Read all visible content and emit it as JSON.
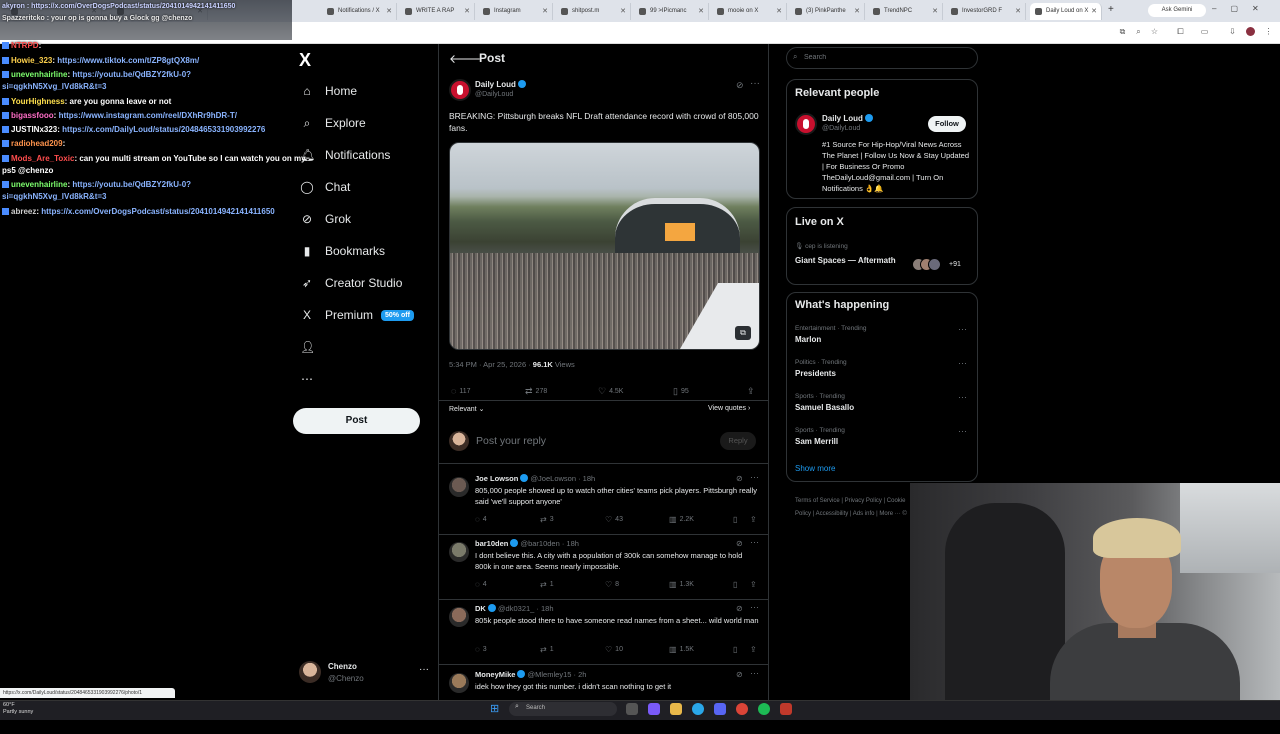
{
  "browser": {
    "tabs": [
      {
        "label": "",
        "x": 0
      },
      {
        "label": "",
        "x": 0
      },
      {
        "label": "Notifications / X",
        "x": 0
      },
      {
        "label": "WRITE A RAP",
        "x": 0
      },
      {
        "label": "Instagram",
        "x": 0
      },
      {
        "label": "shitpost.m",
        "x": 0
      },
      {
        "label": "99 >IPicmanc",
        "x": 0
      },
      {
        "label": "mooie on X",
        "x": 0
      },
      {
        "label": "(3) PinkPanthe",
        "x": 0
      },
      {
        "label": "TrendNPC",
        "x": 0
      },
      {
        "label": "InvestorGRD F",
        "x": 0
      },
      {
        "label": "Daily Loud on X",
        "x": 0
      }
    ],
    "ask_gemini": "Ask Gemini"
  },
  "chat": {
    "messages": [
      {
        "user": "NTRPD",
        "text": ":",
        "link": "",
        "ucolor": "#ff4d4d"
      },
      {
        "user": "Howie_323",
        "text": ": ",
        "link": "https://www.tiktok.com/t/ZP8gtQX8m/",
        "ucolor": "#ffd24d"
      },
      {
        "user": "unevenhairline",
        "text": ": ",
        "link": "https://youtu.be/QdBZY2fkU-0?",
        "ucolor": "#7dff6e"
      },
      {
        "user": "",
        "text": "",
        "link": "si=qgkhN5Xvg_lVd8kR&amp;t=3",
        "ucolor": "#ffffff"
      },
      {
        "user": "YourHighness",
        "text": ": are you gonna leave or not",
        "link": "",
        "ucolor": "#ffe04d"
      },
      {
        "user": "bigassfooo",
        "text": ": ",
        "link": "https://www.instagram.com/reel/DXhRr9hDR-T/",
        "ucolor": "#ff6ec7"
      },
      {
        "user": "JUSTINx323",
        "text": ": ",
        "link": "https://x.com/DailyLoud/status/2048465331903992276",
        "ucolor": "#ffffff"
      },
      {
        "user": "radiohead209",
        "text": ":",
        "link": "",
        "ucolor": "#ff944d"
      },
      {
        "user": "Mods_Are_Toxic",
        "text": ": can you multi stream on YouTube so I can watch you on my",
        "link": "",
        "ucolor": "#ff4d4d"
      },
      {
        "user": "",
        "text": "ps5 @chenzo",
        "link": "",
        "ucolor": "#ffffff"
      },
      {
        "user": "unevenhairline",
        "text": ": ",
        "link": "https://youtu.be/QdBZY2fkU-0?",
        "ucolor": "#7dff6e"
      },
      {
        "user": "",
        "text": "",
        "link": "si=qgkhN5Xvg_lVd8kR&amp;t=3",
        "ucolor": "#ffffff"
      },
      {
        "user": "abreez",
        "text": ": ",
        "link": "https://x.com/OverDogsPodcast/status/2041014942141411650",
        "ucolor": "#cfcfcf"
      }
    ],
    "top_line_1": "akyron : https://x.com/OverDogsPodcast/status/2041014942141411650",
    "top_line_2": "Spazzeritcko : your op is gonna buy a Glock gg @chenzo"
  },
  "nav": {
    "logo": "X",
    "items": [
      {
        "label": "Home",
        "icon": "⌂",
        "name": "home"
      },
      {
        "label": "Explore",
        "icon": "⌕",
        "name": "explore"
      },
      {
        "label": "Notifications",
        "icon": "🔔︎",
        "name": "notifications"
      },
      {
        "label": "Chat",
        "icon": "◯",
        "name": "chat"
      },
      {
        "label": "Grok",
        "icon": "⊘",
        "name": "grok"
      },
      {
        "label": "Bookmarks",
        "icon": "▮",
        "name": "bookmarks"
      },
      {
        "label": "Creator Studio",
        "icon": "➶",
        "name": "creator-studio"
      },
      {
        "label": "Premium",
        "icon": "X",
        "name": "premium"
      },
      {
        "label": "",
        "icon": "👤︎",
        "name": "profile"
      },
      {
        "label": "",
        "icon": "⋯",
        "name": "more"
      }
    ],
    "premium_badge": "50% off",
    "post_button": "Post",
    "account": {
      "name": "Chenzo",
      "handle": "@Chenzo"
    }
  },
  "post": {
    "header": "Post",
    "author": "Daily Loud",
    "handle": "@DailyLoud",
    "text": "BREAKING: Pittsburgh breaks NFL Draft attendance record with crowd of 805,000 fans.",
    "time": "5:34 PM · Apr 25, 2026 · ",
    "views": "96.1K",
    "views_label": " Views",
    "stats": {
      "replies": "117",
      "reposts": "278",
      "likes": "4.5K",
      "bookmarks": "95"
    },
    "sort_label": "Relevant",
    "view_quotes": "View quotes",
    "reply_placeholder": "Post your reply",
    "reply_button": "Reply"
  },
  "replies": [
    {
      "name": "Joe Lowson",
      "handle": "@JoeLowson · 18h",
      "text": "805,000 people showed up to watch other cities' teams pick players. Pittsburgh really said 'we'll support anyone'",
      "replies": "4",
      "reposts": "3",
      "likes": "43",
      "views": "2.2K",
      "avcolor": "#6b5a52"
    },
    {
      "name": "bar10den",
      "handle": "@bar10den · 18h",
      "text": "I dont believe this. A city with a population of 300k can somehow manage to hold 800k in one area. Seems nearly impossible.",
      "replies": "4",
      "reposts": "1",
      "likes": "8",
      "views": "1.3K",
      "avcolor": "#7a7a6a"
    },
    {
      "name": "DK",
      "handle": "@dk0321_ · 18h",
      "text": "805k people stood there to have someone read names from a sheet... wild world man",
      "replies": "3",
      "reposts": "1",
      "likes": "10",
      "views": "1.5K",
      "avcolor": "#8a6a5a"
    },
    {
      "name": "MoneyMike",
      "handle": "@Mlemley15 · 2h",
      "text": "idek how they got this number. i didn't scan nothing to get it",
      "replies": "",
      "reposts": "",
      "likes": "",
      "views": "",
      "avcolor": "#9a7a5a"
    }
  ],
  "right": {
    "search_placeholder": "Search",
    "relevant_title": "Relevant people",
    "rp_name": "Daily Loud",
    "rp_handle": "@DailyLoud",
    "follow": "Follow",
    "rp_bio": "#1 Source For Hip-Hop/Viral News Across The Planet | Follow Us Now & Stay Updated | For Business Or Promo TheDailyLoud@gmail.com | Turn On Notifications 👌🔔",
    "live_title": "Live on X",
    "live_status": "cep is listening",
    "live_space": "Giant Spaces — Aftermath",
    "live_count": "+91",
    "happening_title": "What's happening",
    "trends": [
      {
        "cat": "Entertainment · Trending",
        "name": "Marlon"
      },
      {
        "cat": "Politics · Trending",
        "name": "Presidents"
      },
      {
        "cat": "Sports · Trending",
        "name": "Samuel Basallo"
      },
      {
        "cat": "Sports · Trending",
        "name": "Sam Merrill"
      }
    ],
    "show_more": "Show more",
    "footer": "Terms of Service | Privacy Policy | Cookie Policy | Accessibility | Ads info | More ··· ©"
  },
  "taskbar": {
    "weather_temp": "60°F",
    "weather_text": "Partly sunny",
    "search": "Search",
    "status_url": "https://x.com/DailyLoud/status/2048465331903992276/photo/1"
  }
}
